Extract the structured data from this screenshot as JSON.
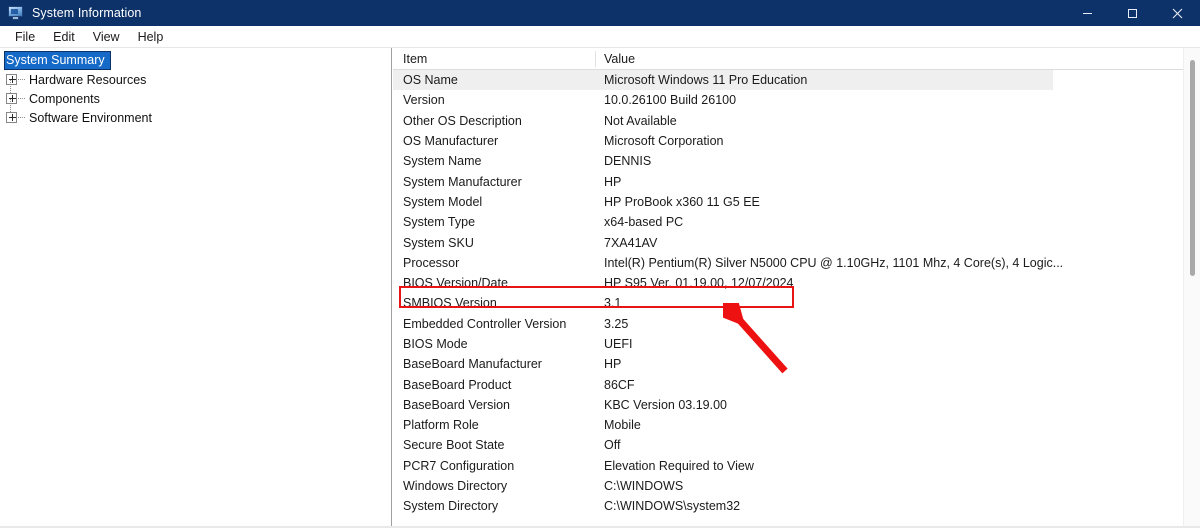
{
  "window": {
    "title": "System Information",
    "icon": "computer-monitor-icon",
    "controls": {
      "minimize": "–",
      "maximize": "☐",
      "close": "✕"
    },
    "titlebar_color": "#0d3269"
  },
  "menubar": {
    "items": [
      "File",
      "Edit",
      "View",
      "Help"
    ]
  },
  "tree": {
    "selected": "System Summary",
    "nodes": [
      {
        "label": "System Summary",
        "expandable": false,
        "selected": true
      },
      {
        "label": "Hardware Resources",
        "expandable": true,
        "selected": false
      },
      {
        "label": "Components",
        "expandable": true,
        "selected": false
      },
      {
        "label": "Software Environment",
        "expandable": true,
        "selected": false
      }
    ]
  },
  "list": {
    "columns": [
      "Item",
      "Value"
    ],
    "rows": [
      {
        "item": "OS Name",
        "value": "Microsoft Windows 11 Pro Education",
        "selected": true,
        "highlight": false
      },
      {
        "item": "Version",
        "value": "10.0.26100 Build 26100",
        "selected": false,
        "highlight": false
      },
      {
        "item": "Other OS Description",
        "value": "Not Available",
        "selected": false,
        "highlight": false
      },
      {
        "item": "OS Manufacturer",
        "value": "Microsoft Corporation",
        "selected": false,
        "highlight": false
      },
      {
        "item": "System Name",
        "value": "DENNIS",
        "selected": false,
        "highlight": false
      },
      {
        "item": "System Manufacturer",
        "value": "HP",
        "selected": false,
        "highlight": false
      },
      {
        "item": "System Model",
        "value": "HP ProBook x360 11 G5 EE",
        "selected": false,
        "highlight": false
      },
      {
        "item": "System Type",
        "value": "x64-based PC",
        "selected": false,
        "highlight": false
      },
      {
        "item": "System SKU",
        "value": "7XA41AV",
        "selected": false,
        "highlight": false
      },
      {
        "item": "Processor",
        "value": "Intel(R) Pentium(R) Silver N5000 CPU @ 1.10GHz, 1101 Mhz, 4 Core(s), 4 Logic...",
        "selected": false,
        "highlight": false
      },
      {
        "item": "BIOS Version/Date",
        "value": "HP S95 Ver. 01.19.00, 12/07/2024",
        "selected": false,
        "highlight": true
      },
      {
        "item": "SMBIOS Version",
        "value": "3.1",
        "selected": false,
        "highlight": false
      },
      {
        "item": "Embedded Controller Version",
        "value": "3.25",
        "selected": false,
        "highlight": false
      },
      {
        "item": "BIOS Mode",
        "value": "UEFI",
        "selected": false,
        "highlight": false
      },
      {
        "item": "BaseBoard Manufacturer",
        "value": "HP",
        "selected": false,
        "highlight": false
      },
      {
        "item": "BaseBoard Product",
        "value": "86CF",
        "selected": false,
        "highlight": false
      },
      {
        "item": "BaseBoard Version",
        "value": "KBC Version 03.19.00",
        "selected": false,
        "highlight": false
      },
      {
        "item": "Platform Role",
        "value": "Mobile",
        "selected": false,
        "highlight": false
      },
      {
        "item": "Secure Boot State",
        "value": "Off",
        "selected": false,
        "highlight": false
      },
      {
        "item": "PCR7 Configuration",
        "value": "Elevation Required to View",
        "selected": false,
        "highlight": false
      },
      {
        "item": "Windows Directory",
        "value": "C:\\WINDOWS",
        "selected": false,
        "highlight": false
      },
      {
        "item": "System Directory",
        "value": "C:\\WINDOWS\\system32",
        "selected": false,
        "highlight": false
      }
    ]
  },
  "annotation": {
    "color": "#e81414",
    "box_target": "BIOS Version/Date",
    "arrow": "red-arrow-pointing-up-left"
  }
}
